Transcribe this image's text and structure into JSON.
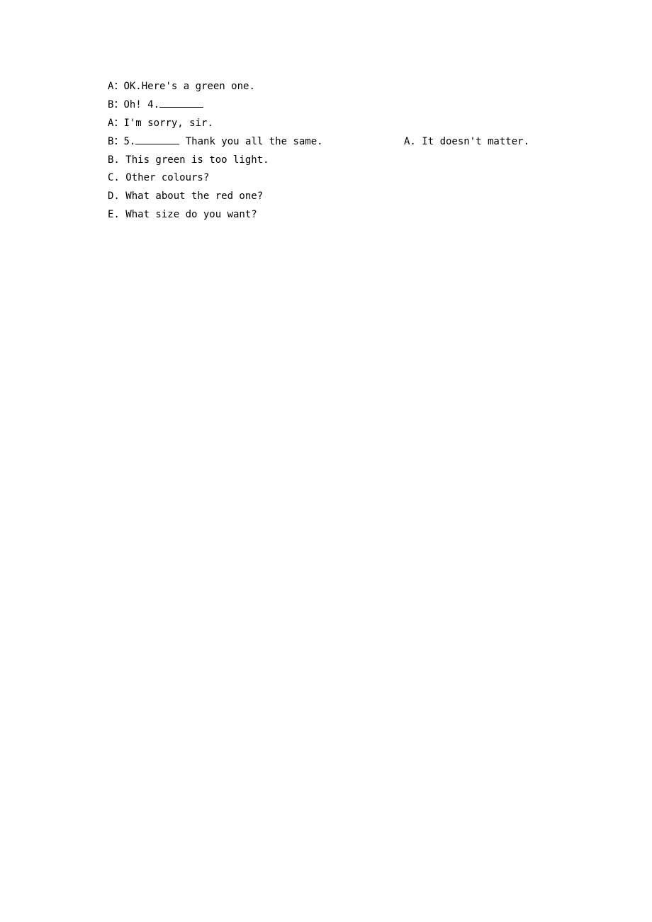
{
  "dialogue": {
    "line1_speaker": "A：",
    "line1_text": "OK.Here's a green one.",
    "line2_speaker": "B：",
    "line2_prefix": "Oh! 4.",
    "line3_speaker": "A：",
    "line3_text": "I'm sorry, sir.",
    "line4_speaker": "B：",
    "line4_prefix": "5.",
    "line4_suffix": " Thank you all the same."
  },
  "options": {
    "a": "A. It doesn't matter.",
    "b": "B. This green is too light.",
    "c": "C. Other colours?",
    "d": "D. What about the red one?",
    "e": "E. What size do you want?"
  }
}
